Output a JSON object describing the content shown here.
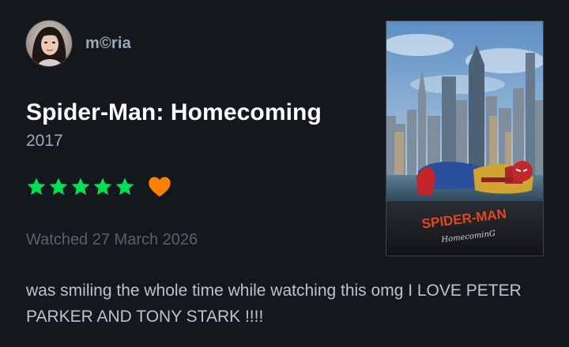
{
  "user": {
    "name": "m©ria",
    "avatar_icon": "user-avatar-photo"
  },
  "film": {
    "title": "Spider-Man: Homecoming",
    "year": "2017",
    "poster": {
      "title_text": "SPIDER-MAN",
      "subtitle_text": "HomecominG"
    }
  },
  "rating": {
    "stars": 5,
    "max_stars": 5,
    "liked": true,
    "star_color": "#00e054",
    "heart_color": "#ff8000",
    "star_icon": "star-icon",
    "heart_icon": "heart-icon"
  },
  "watched_text": "Watched 27 March 2026",
  "review_text": "was smiling the whole time while watching this omg I LOVE PETER PARKER AND TONY STARK !!!!",
  "colors": {
    "background": "#14181c",
    "muted_text": "#99aabb",
    "review_text": "#b8c4d0"
  }
}
